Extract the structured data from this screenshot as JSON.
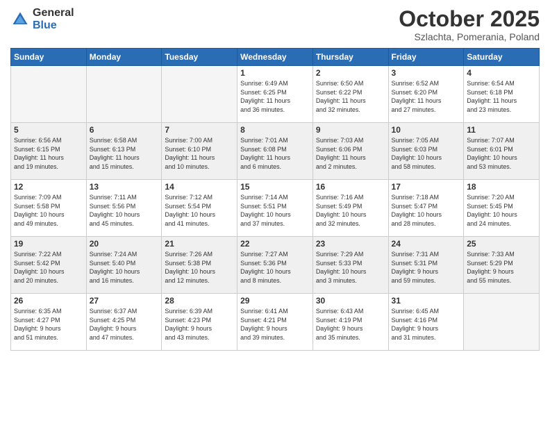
{
  "logo": {
    "text_general": "General",
    "text_blue": "Blue"
  },
  "header": {
    "month": "October 2025",
    "location": "Szlachta, Pomerania, Poland"
  },
  "weekdays": [
    "Sunday",
    "Monday",
    "Tuesday",
    "Wednesday",
    "Thursday",
    "Friday",
    "Saturday"
  ],
  "weeks": [
    [
      {
        "day": "",
        "info": ""
      },
      {
        "day": "",
        "info": ""
      },
      {
        "day": "",
        "info": ""
      },
      {
        "day": "1",
        "info": "Sunrise: 6:49 AM\nSunset: 6:25 PM\nDaylight: 11 hours\nand 36 minutes."
      },
      {
        "day": "2",
        "info": "Sunrise: 6:50 AM\nSunset: 6:22 PM\nDaylight: 11 hours\nand 32 minutes."
      },
      {
        "day": "3",
        "info": "Sunrise: 6:52 AM\nSunset: 6:20 PM\nDaylight: 11 hours\nand 27 minutes."
      },
      {
        "day": "4",
        "info": "Sunrise: 6:54 AM\nSunset: 6:18 PM\nDaylight: 11 hours\nand 23 minutes."
      }
    ],
    [
      {
        "day": "5",
        "info": "Sunrise: 6:56 AM\nSunset: 6:15 PM\nDaylight: 11 hours\nand 19 minutes."
      },
      {
        "day": "6",
        "info": "Sunrise: 6:58 AM\nSunset: 6:13 PM\nDaylight: 11 hours\nand 15 minutes."
      },
      {
        "day": "7",
        "info": "Sunrise: 7:00 AM\nSunset: 6:10 PM\nDaylight: 11 hours\nand 10 minutes."
      },
      {
        "day": "8",
        "info": "Sunrise: 7:01 AM\nSunset: 6:08 PM\nDaylight: 11 hours\nand 6 minutes."
      },
      {
        "day": "9",
        "info": "Sunrise: 7:03 AM\nSunset: 6:06 PM\nDaylight: 11 hours\nand 2 minutes."
      },
      {
        "day": "10",
        "info": "Sunrise: 7:05 AM\nSunset: 6:03 PM\nDaylight: 10 hours\nand 58 minutes."
      },
      {
        "day": "11",
        "info": "Sunrise: 7:07 AM\nSunset: 6:01 PM\nDaylight: 10 hours\nand 53 minutes."
      }
    ],
    [
      {
        "day": "12",
        "info": "Sunrise: 7:09 AM\nSunset: 5:58 PM\nDaylight: 10 hours\nand 49 minutes."
      },
      {
        "day": "13",
        "info": "Sunrise: 7:11 AM\nSunset: 5:56 PM\nDaylight: 10 hours\nand 45 minutes."
      },
      {
        "day": "14",
        "info": "Sunrise: 7:12 AM\nSunset: 5:54 PM\nDaylight: 10 hours\nand 41 minutes."
      },
      {
        "day": "15",
        "info": "Sunrise: 7:14 AM\nSunset: 5:51 PM\nDaylight: 10 hours\nand 37 minutes."
      },
      {
        "day": "16",
        "info": "Sunrise: 7:16 AM\nSunset: 5:49 PM\nDaylight: 10 hours\nand 32 minutes."
      },
      {
        "day": "17",
        "info": "Sunrise: 7:18 AM\nSunset: 5:47 PM\nDaylight: 10 hours\nand 28 minutes."
      },
      {
        "day": "18",
        "info": "Sunrise: 7:20 AM\nSunset: 5:45 PM\nDaylight: 10 hours\nand 24 minutes."
      }
    ],
    [
      {
        "day": "19",
        "info": "Sunrise: 7:22 AM\nSunset: 5:42 PM\nDaylight: 10 hours\nand 20 minutes."
      },
      {
        "day": "20",
        "info": "Sunrise: 7:24 AM\nSunset: 5:40 PM\nDaylight: 10 hours\nand 16 minutes."
      },
      {
        "day": "21",
        "info": "Sunrise: 7:26 AM\nSunset: 5:38 PM\nDaylight: 10 hours\nand 12 minutes."
      },
      {
        "day": "22",
        "info": "Sunrise: 7:27 AM\nSunset: 5:36 PM\nDaylight: 10 hours\nand 8 minutes."
      },
      {
        "day": "23",
        "info": "Sunrise: 7:29 AM\nSunset: 5:33 PM\nDaylight: 10 hours\nand 3 minutes."
      },
      {
        "day": "24",
        "info": "Sunrise: 7:31 AM\nSunset: 5:31 PM\nDaylight: 9 hours\nand 59 minutes."
      },
      {
        "day": "25",
        "info": "Sunrise: 7:33 AM\nSunset: 5:29 PM\nDaylight: 9 hours\nand 55 minutes."
      }
    ],
    [
      {
        "day": "26",
        "info": "Sunrise: 6:35 AM\nSunset: 4:27 PM\nDaylight: 9 hours\nand 51 minutes."
      },
      {
        "day": "27",
        "info": "Sunrise: 6:37 AM\nSunset: 4:25 PM\nDaylight: 9 hours\nand 47 minutes."
      },
      {
        "day": "28",
        "info": "Sunrise: 6:39 AM\nSunset: 4:23 PM\nDaylight: 9 hours\nand 43 minutes."
      },
      {
        "day": "29",
        "info": "Sunrise: 6:41 AM\nSunset: 4:21 PM\nDaylight: 9 hours\nand 39 minutes."
      },
      {
        "day": "30",
        "info": "Sunrise: 6:43 AM\nSunset: 4:19 PM\nDaylight: 9 hours\nand 35 minutes."
      },
      {
        "day": "31",
        "info": "Sunrise: 6:45 AM\nSunset: 4:16 PM\nDaylight: 9 hours\nand 31 minutes."
      },
      {
        "day": "",
        "info": ""
      }
    ]
  ]
}
